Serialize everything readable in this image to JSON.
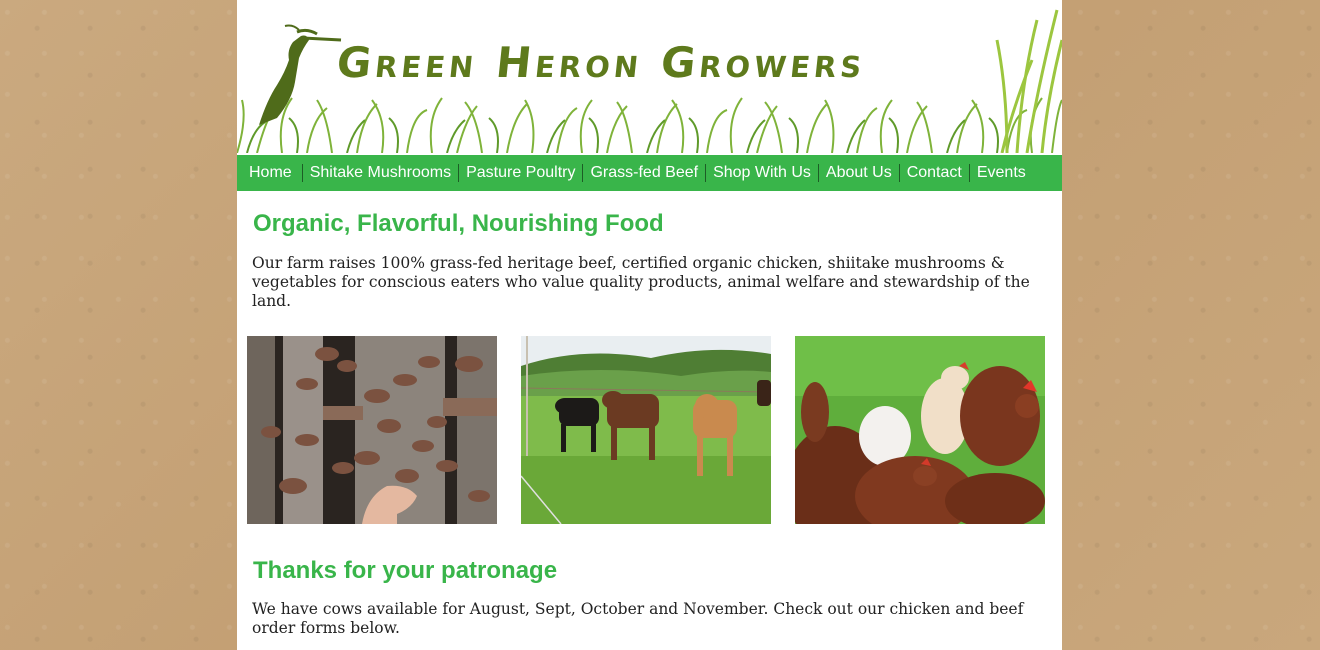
{
  "header": {
    "site_title": "Green Heron Growers",
    "logo_icon": "heron-icon"
  },
  "nav": {
    "items": [
      {
        "label": "Home"
      },
      {
        "label": "Shitake Mushrooms"
      },
      {
        "label": "Pasture Poultry"
      },
      {
        "label": "Grass-fed Beef"
      },
      {
        "label": "Shop With Us"
      },
      {
        "label": "About Us"
      },
      {
        "label": "Contact"
      },
      {
        "label": "Events"
      }
    ]
  },
  "main": {
    "heading": "Organic, Flavorful, Nourishing Food",
    "intro": "Our farm raises 100% grass-fed heritage beef, certified organic chicken, shiitake mushrooms & vegetables for conscious eaters who value quality products, animal welfare and stewardship of the land.",
    "photos": [
      {
        "subject": "shiitake-mushrooms-photo"
      },
      {
        "subject": "cattle-pasture-photo"
      },
      {
        "subject": "chickens-photo"
      }
    ],
    "section2_heading": "Thanks for your patronage",
    "section2_text": "We have cows available for August, Sept, October and November. Check out our chicken and beef order forms below."
  },
  "colors": {
    "accent_green": "#39b54a",
    "logo_green": "#5e7a1c",
    "background_kraft": "#c8a67b"
  }
}
